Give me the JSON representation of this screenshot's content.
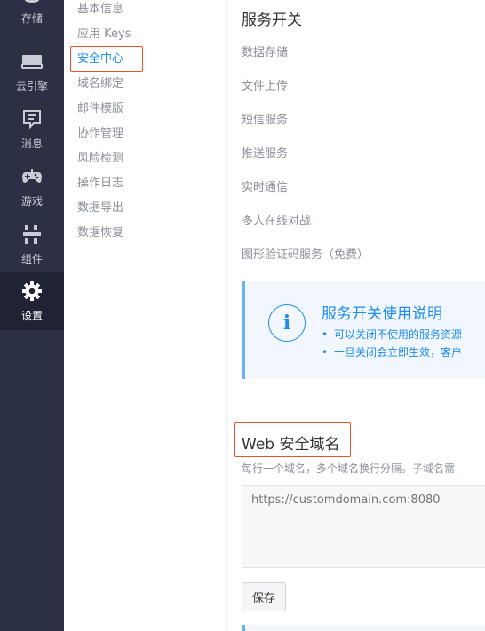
{
  "rail": {
    "items": [
      {
        "label": "存储",
        "icon": "database-icon"
      },
      {
        "label": "云引擎",
        "icon": "cloud-engine-icon"
      },
      {
        "label": "消息",
        "icon": "message-icon"
      },
      {
        "label": "游戏",
        "icon": "gamepad-icon"
      },
      {
        "label": "组件",
        "icon": "components-icon"
      },
      {
        "label": "设置",
        "icon": "gear-icon",
        "active": true
      }
    ]
  },
  "submenu": {
    "items": [
      {
        "label": "基本信息"
      },
      {
        "label": "应用 Keys"
      },
      {
        "label": "安全中心",
        "active": true
      },
      {
        "label": "域名绑定"
      },
      {
        "label": "邮件模版"
      },
      {
        "label": "协作管理"
      },
      {
        "label": "风险检测"
      },
      {
        "label": "操作日志"
      },
      {
        "label": "数据导出"
      },
      {
        "label": "数据恢复"
      }
    ]
  },
  "services": {
    "title": "服务开关",
    "rows": [
      "数据存储",
      "文件上传",
      "短信服务",
      "推送服务",
      "实时通信",
      "多人在线对战",
      "图形验证码服务（免费）"
    ]
  },
  "info": {
    "icon_char": "i",
    "title": "服务开关使用说明",
    "lines": [
      "可以关闭不使用的服务资源",
      "一旦关闭会立即生效，客户"
    ]
  },
  "web_domain": {
    "title": "Web 安全域名",
    "hint": "每行一个域名，多个域名换行分隔。子域名需",
    "placeholder": "https://customdomain.com:8080",
    "save_label": "保存"
  },
  "colors": {
    "accent": "#1f8ceb",
    "highlight": "#e8532a",
    "rail_bg": "#2b3044"
  }
}
